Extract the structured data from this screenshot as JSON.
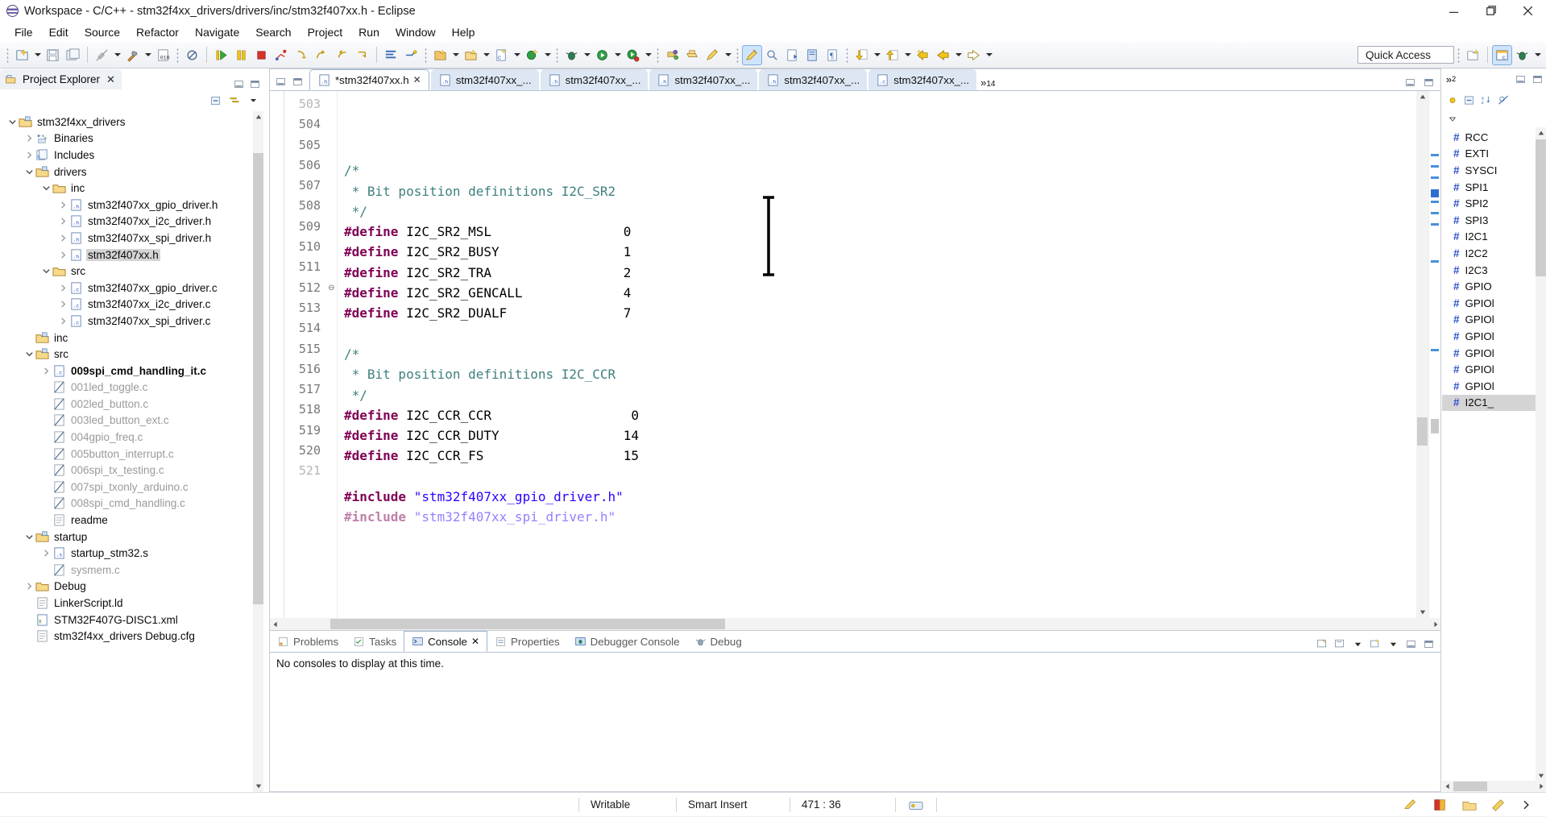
{
  "window": {
    "title": "Workspace - C/C++ - stm32f4xx_drivers/drivers/inc/stm32f407xx.h - Eclipse",
    "minimize_label": "Minimize",
    "maximize_label": "Restore",
    "close_label": "Close"
  },
  "menu": {
    "items": [
      {
        "label": "File"
      },
      {
        "label": "Edit"
      },
      {
        "label": "Source"
      },
      {
        "label": "Refactor"
      },
      {
        "label": "Navigate"
      },
      {
        "label": "Search"
      },
      {
        "label": "Project"
      },
      {
        "label": "Run"
      },
      {
        "label": "Window"
      },
      {
        "label": "Help"
      }
    ]
  },
  "toolbar": {
    "quick_access_placeholder": "Quick Access",
    "buttons": [
      "new-wizard-icon",
      "save-icon",
      "save-all-icon",
      "build-disabled-icon",
      "build-hammer-icon",
      "build-binary-icon",
      "no-entry-icon",
      "resume-icon",
      "suspend-icon",
      "terminate-icon",
      "disconnect-icon",
      "step-into-icon",
      "step-over-icon",
      "step-return-icon",
      "align-icon",
      "toggle-icon",
      "new-c-project-icon",
      "new-folder-icon",
      "new-class-icon",
      "new-source-icon",
      "debug-icon",
      "run-icon",
      "run-external-icon",
      "profile-icon",
      "open-type-icon",
      "open-task-icon",
      "pencil-icon",
      "marker-icon",
      "search-icon",
      "next-annotation-icon",
      "previous-annotation-icon",
      "pilcrow-icon",
      "last-edit-icon",
      "bookmark-icon",
      "back-to-icon",
      "back-icon",
      "forward-icon"
    ]
  },
  "explorer": {
    "tab_label": "Project Explorer",
    "close_label": "✕",
    "collapse_all_label": "collapse-all",
    "link_editor_label": "link-with-editor",
    "tree": [
      {
        "label": "stm32f4xx_drivers",
        "indent": 0,
        "twist": "open",
        "icon": "project-folder-icon",
        "style": "normal"
      },
      {
        "label": "Binaries",
        "indent": 1,
        "twist": "closed",
        "icon": "binaries-icon",
        "style": "normal"
      },
      {
        "label": "Includes",
        "indent": 1,
        "twist": "closed",
        "icon": "includes-icon",
        "style": "normal"
      },
      {
        "label": "drivers",
        "indent": 1,
        "twist": "open",
        "icon": "source-folder-icon",
        "style": "normal"
      },
      {
        "label": "inc",
        "indent": 2,
        "twist": "open",
        "icon": "folder-icon",
        "style": "normal"
      },
      {
        "label": "stm32f407xx_gpio_driver.h",
        "indent": 3,
        "twist": "closed",
        "icon": "header-file-icon",
        "style": "normal"
      },
      {
        "label": "stm32f407xx_i2c_driver.h",
        "indent": 3,
        "twist": "closed",
        "icon": "header-file-icon",
        "style": "normal"
      },
      {
        "label": "stm32f407xx_spi_driver.h",
        "indent": 3,
        "twist": "closed",
        "icon": "header-file-icon",
        "style": "normal"
      },
      {
        "label": "stm32f407xx.h",
        "indent": 3,
        "twist": "closed",
        "icon": "header-file-icon",
        "style": "selected"
      },
      {
        "label": "src",
        "indent": 2,
        "twist": "open",
        "icon": "folder-icon",
        "style": "normal"
      },
      {
        "label": "stm32f407xx_gpio_driver.c",
        "indent": 3,
        "twist": "closed",
        "icon": "c-file-icon",
        "style": "normal"
      },
      {
        "label": "stm32f407xx_i2c_driver.c",
        "indent": 3,
        "twist": "closed",
        "icon": "c-file-icon",
        "style": "normal"
      },
      {
        "label": "stm32f407xx_spi_driver.c",
        "indent": 3,
        "twist": "closed",
        "icon": "c-file-icon",
        "style": "normal"
      },
      {
        "label": "inc",
        "indent": 1,
        "twist": "none",
        "icon": "source-folder-icon",
        "style": "normal"
      },
      {
        "label": "src",
        "indent": 1,
        "twist": "open",
        "icon": "source-folder-icon",
        "style": "normal"
      },
      {
        "label": "009spi_cmd_handling_it.c",
        "indent": 2,
        "twist": "closed",
        "icon": "c-file-icon",
        "style": "bold"
      },
      {
        "label": "001led_toggle.c",
        "indent": 2,
        "twist": "none",
        "icon": "excluded-file-icon",
        "style": "dim"
      },
      {
        "label": "002led_button.c",
        "indent": 2,
        "twist": "none",
        "icon": "excluded-file-icon",
        "style": "dim"
      },
      {
        "label": "003led_button_ext.c",
        "indent": 2,
        "twist": "none",
        "icon": "excluded-file-icon",
        "style": "dim"
      },
      {
        "label": "004gpio_freq.c",
        "indent": 2,
        "twist": "none",
        "icon": "excluded-file-icon",
        "style": "dim"
      },
      {
        "label": "005button_interrupt.c",
        "indent": 2,
        "twist": "none",
        "icon": "excluded-file-icon",
        "style": "dim"
      },
      {
        "label": "006spi_tx_testing.c",
        "indent": 2,
        "twist": "none",
        "icon": "excluded-file-icon",
        "style": "dim"
      },
      {
        "label": "007spi_txonly_arduino.c",
        "indent": 2,
        "twist": "none",
        "icon": "excluded-file-icon",
        "style": "dim"
      },
      {
        "label": "008spi_cmd_handling.c",
        "indent": 2,
        "twist": "none",
        "icon": "excluded-file-icon",
        "style": "dim"
      },
      {
        "label": "readme",
        "indent": 2,
        "twist": "none",
        "icon": "text-file-icon",
        "style": "normal"
      },
      {
        "label": "startup",
        "indent": 1,
        "twist": "open",
        "icon": "source-folder-icon",
        "style": "normal"
      },
      {
        "label": "startup_stm32.s",
        "indent": 2,
        "twist": "closed",
        "icon": "asm-file-icon",
        "style": "normal"
      },
      {
        "label": "sysmem.c",
        "indent": 2,
        "twist": "none",
        "icon": "excluded-file-icon",
        "style": "dim"
      },
      {
        "label": "Debug",
        "indent": 1,
        "twist": "closed",
        "icon": "folder-icon",
        "style": "normal"
      },
      {
        "label": "LinkerScript.ld",
        "indent": 1,
        "twist": "none",
        "icon": "text-file-icon",
        "style": "normal"
      },
      {
        "label": "STM32F407G-DISC1.xml",
        "indent": 1,
        "twist": "none",
        "icon": "xml-file-icon",
        "style": "normal"
      },
      {
        "label": "stm32f4xx_drivers Debug.cfg",
        "indent": 1,
        "twist": "none",
        "icon": "text-file-icon",
        "style": "normal"
      }
    ]
  },
  "editor": {
    "tabs": [
      {
        "label": "*stm32f407xx.h",
        "active": true,
        "icon": "header-file-icon",
        "closeable": true
      },
      {
        "label": "stm32f407xx_...",
        "active": false,
        "icon": "header-file-icon",
        "closeable": false
      },
      {
        "label": "stm32f407xx_...",
        "active": false,
        "icon": "header-file-icon",
        "closeable": false
      },
      {
        "label": "stm32f407xx_...",
        "active": false,
        "icon": "header-file-icon",
        "closeable": false
      },
      {
        "label": "stm32f407xx_...",
        "active": false,
        "icon": "header-file-icon",
        "closeable": false
      },
      {
        "label": "stm32f407xx_...",
        "active": false,
        "icon": "c-file-icon",
        "closeable": false
      }
    ],
    "overflow_label": "»",
    "overflow_count": "14",
    "lines": [
      {
        "num": "503",
        "partial": true,
        "segments": []
      },
      {
        "num": "504",
        "segments": [
          {
            "t": "/*",
            "c": "c-comment"
          }
        ]
      },
      {
        "num": "505",
        "segments": [
          {
            "t": " * Bit position definitions I2C_SR2",
            "c": "c-comment"
          }
        ]
      },
      {
        "num": "506",
        "segments": [
          {
            "t": " */",
            "c": "c-comment"
          }
        ]
      },
      {
        "num": "507",
        "segments": [
          {
            "t": "#define",
            "c": "c-pre"
          },
          {
            "t": " I2C_SR2_MSL",
            "c": "c-ident"
          },
          {
            "t": "                 0",
            "c": "c-num"
          }
        ]
      },
      {
        "num": "508",
        "segments": [
          {
            "t": "#define",
            "c": "c-pre"
          },
          {
            "t": " I2C_SR2_BUSY",
            "c": "c-ident"
          },
          {
            "t": "                1",
            "c": "c-num"
          }
        ]
      },
      {
        "num": "509",
        "segments": [
          {
            "t": "#define",
            "c": "c-pre"
          },
          {
            "t": " I2C_SR2_TRA",
            "c": "c-ident"
          },
          {
            "t": "                 2",
            "c": "c-num"
          }
        ]
      },
      {
        "num": "510",
        "segments": [
          {
            "t": "#define",
            "c": "c-pre"
          },
          {
            "t": " I2C_SR2_GENCALL",
            "c": "c-ident"
          },
          {
            "t": "             4",
            "c": "c-num"
          }
        ]
      },
      {
        "num": "511",
        "segments": [
          {
            "t": "#define",
            "c": "c-pre"
          },
          {
            "t": " I2C_SR2_DUALF",
            "c": "c-ident"
          },
          {
            "t": "               7",
            "c": "c-num"
          }
        ]
      },
      {
        "num": "512",
        "fold": true,
        "segments": []
      },
      {
        "num": "513",
        "segments": [
          {
            "t": "/*",
            "c": "c-comment"
          }
        ]
      },
      {
        "num": "514",
        "segments": [
          {
            "t": " * Bit position definitions I2C_CCR",
            "c": "c-comment"
          }
        ]
      },
      {
        "num": "515",
        "segments": [
          {
            "t": " */",
            "c": "c-comment"
          }
        ]
      },
      {
        "num": "516",
        "segments": [
          {
            "t": "#define",
            "c": "c-pre"
          },
          {
            "t": " I2C_CCR_CCR",
            "c": "c-ident"
          },
          {
            "t": "                  0",
            "c": "c-num"
          }
        ]
      },
      {
        "num": "517",
        "segments": [
          {
            "t": "#define",
            "c": "c-pre"
          },
          {
            "t": " I2C_CCR_DUTY",
            "c": "c-ident"
          },
          {
            "t": "                14",
            "c": "c-num"
          }
        ]
      },
      {
        "num": "518",
        "segments": [
          {
            "t": "#define",
            "c": "c-pre"
          },
          {
            "t": " I2C_CCR_FS",
            "c": "c-ident"
          },
          {
            "t": "                  15",
            "c": "c-num"
          }
        ]
      },
      {
        "num": "519",
        "segments": []
      },
      {
        "num": "520",
        "segments": [
          {
            "t": "#include",
            "c": "c-pre"
          },
          {
            "t": " ",
            "c": "c-ident"
          },
          {
            "t": "\"stm32f407xx_gpio_driver.h\"",
            "c": "c-str"
          }
        ]
      },
      {
        "num": "521",
        "partial": true,
        "segments": [
          {
            "t": "#include",
            "c": "c-pre"
          },
          {
            "t": " ",
            "c": "c-ident"
          },
          {
            "t": "\"stm32f407xx_spi_driver.h\"",
            "c": "c-str"
          }
        ]
      }
    ]
  },
  "console": {
    "tabs": [
      {
        "label": "Problems",
        "icon": "problems-icon",
        "active": false,
        "closeable": false
      },
      {
        "label": "Tasks",
        "icon": "tasks-icon",
        "active": false,
        "closeable": false
      },
      {
        "label": "Console",
        "icon": "console-icon",
        "active": true,
        "closeable": true
      },
      {
        "label": "Properties",
        "icon": "properties-icon",
        "active": false,
        "closeable": false
      },
      {
        "label": "Debugger Console",
        "icon": "debugger-icon",
        "active": false,
        "closeable": false
      },
      {
        "label": "Debug",
        "icon": "debug-icon",
        "active": false,
        "closeable": false
      }
    ],
    "message": "No consoles to display at this time."
  },
  "outline": {
    "items": [
      {
        "label": "RCC",
        "selected": false
      },
      {
        "label": "EXTI",
        "selected": false
      },
      {
        "label": "SYSCI",
        "selected": false
      },
      {
        "label": "SPI1",
        "selected": false
      },
      {
        "label": "SPI2",
        "selected": false
      },
      {
        "label": "SPI3",
        "selected": false
      },
      {
        "label": "I2C1",
        "selected": false
      },
      {
        "label": "I2C2",
        "selected": false
      },
      {
        "label": "I2C3",
        "selected": false
      },
      {
        "label": "GPIO",
        "selected": false
      },
      {
        "label": "GPIOl",
        "selected": false
      },
      {
        "label": "GPIOl",
        "selected": false
      },
      {
        "label": "GPIOl",
        "selected": false
      },
      {
        "label": "GPIOl",
        "selected": false
      },
      {
        "label": "GPIOl",
        "selected": false
      },
      {
        "label": "GPIOl",
        "selected": false
      },
      {
        "label": "I2C1_",
        "selected": true
      }
    ]
  },
  "statusbar": {
    "writable": "Writable",
    "insert_mode": "Smart Insert",
    "position": "471 : 36"
  },
  "colors": {
    "accent": "#cfe4fb",
    "tab_active": "#ffffff",
    "tab_inactive": "#dde7f3",
    "comment": "#3f7f7f",
    "preproc": "#7f0055",
    "string": "#2a00ff",
    "selection": "#d4d4d4"
  }
}
